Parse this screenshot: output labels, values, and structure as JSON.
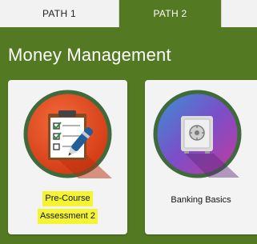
{
  "tabs": [
    {
      "label": "PATH 1",
      "active": false
    },
    {
      "label": "PATH 2",
      "active": true
    },
    {
      "label": "",
      "active": false
    }
  ],
  "section": {
    "title": "Money Management"
  },
  "cards": [
    {
      "label_line1": "Pre-Course",
      "label_line2": "Assessment 2",
      "highlighted": true,
      "icon": "checklist-pen-icon"
    },
    {
      "label": "Banking Basics",
      "highlighted": false,
      "icon": "safe-icon"
    }
  ],
  "colors": {
    "background_green": "#537a22",
    "highlight_yellow": "#f4f432",
    "card_bg": "#f3f3f3"
  }
}
